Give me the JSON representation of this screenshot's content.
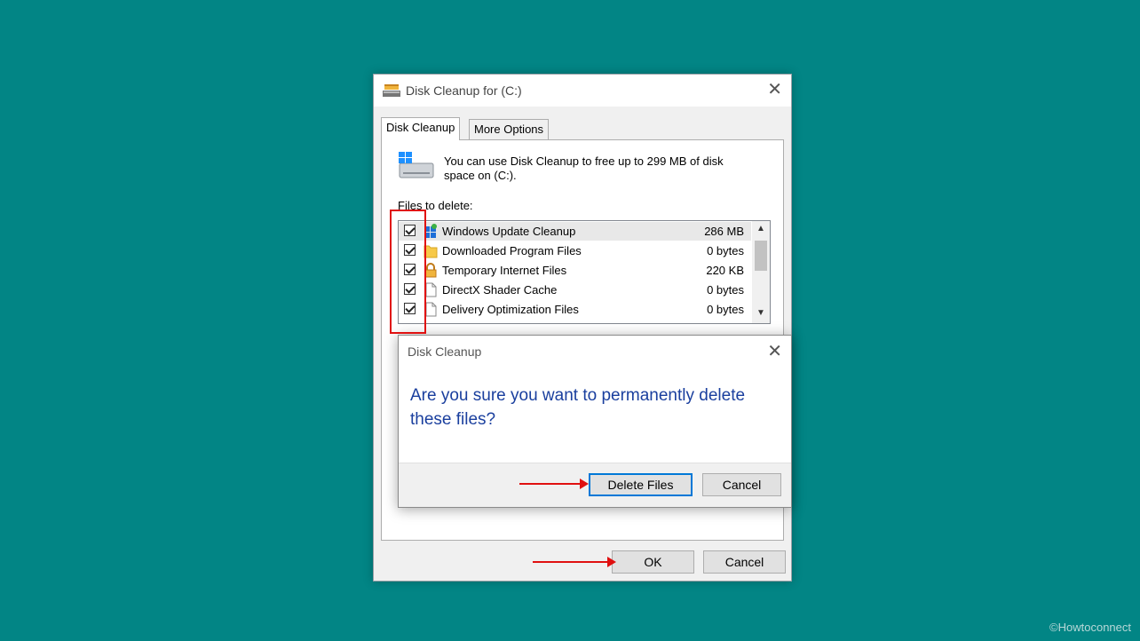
{
  "window": {
    "title": "Disk Cleanup for  (C:)",
    "tabs": [
      {
        "label": "Disk Cleanup",
        "active": true
      },
      {
        "label": "More Options",
        "active": false
      }
    ],
    "description": "You can use Disk Cleanup to free up to 299 MB of disk space on  (C:).",
    "files_label": "Files to delete:",
    "files": [
      {
        "name": "Windows Update Cleanup",
        "size": "286 MB",
        "checked": true,
        "icon": "windows-update-icon"
      },
      {
        "name": "Downloaded Program Files",
        "size": "0 bytes",
        "checked": true,
        "icon": "folder-icon"
      },
      {
        "name": "Temporary Internet Files",
        "size": "220 KB",
        "checked": true,
        "icon": "lock-icon"
      },
      {
        "name": "DirectX Shader Cache",
        "size": "0 bytes",
        "checked": true,
        "icon": "file-icon"
      },
      {
        "name": "Delivery Optimization Files",
        "size": "0 bytes",
        "checked": true,
        "icon": "file-icon"
      }
    ],
    "ok_label": "OK",
    "cancel_label": "Cancel"
  },
  "dialog": {
    "title": "Disk Cleanup",
    "message": "Are you sure you want to permanently delete these files?",
    "delete_label": "Delete Files",
    "cancel_label": "Cancel"
  },
  "watermark": "©Howtoconnect",
  "colors": {
    "background": "#028585",
    "accent": "#0078d7",
    "message": "#1a3f9e",
    "annotation": "#e01010"
  }
}
